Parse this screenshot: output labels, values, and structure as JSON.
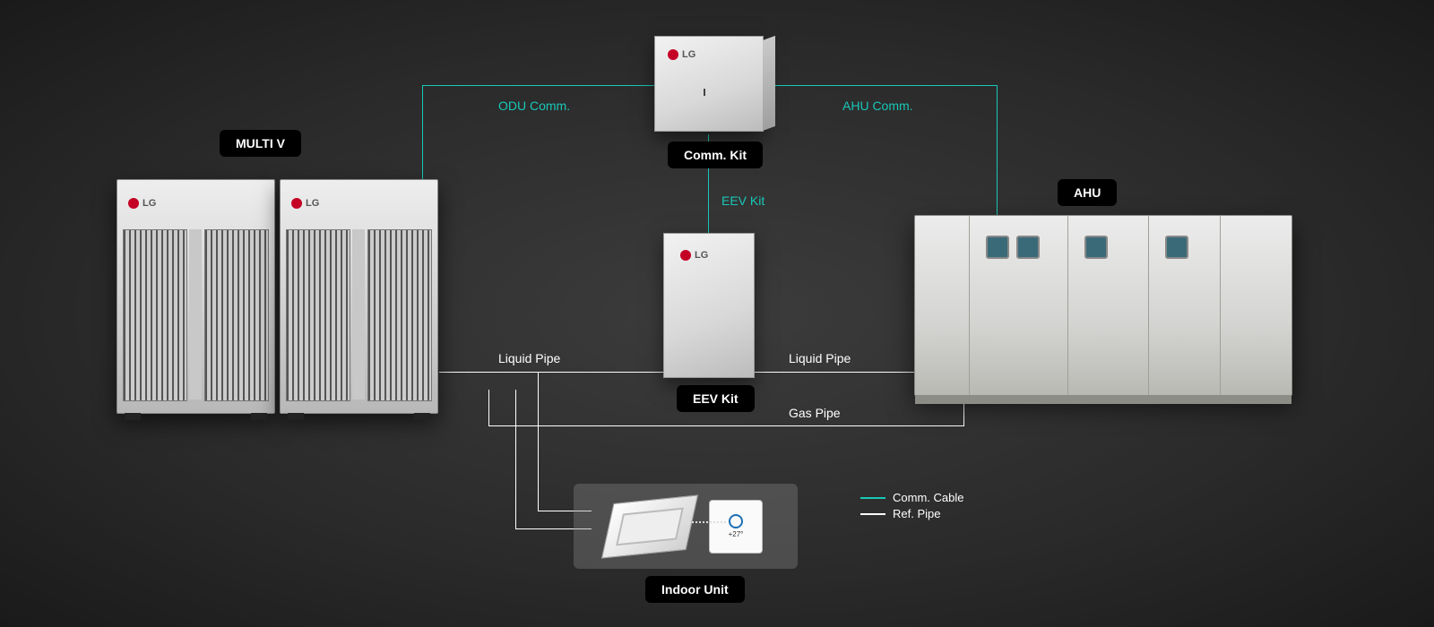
{
  "labels": {
    "multi_v": "MULTI V",
    "comm_kit": "Comm. Kit",
    "eev_kit": "EEV Kit",
    "ahu": "AHU",
    "indoor_unit": "Indoor Unit"
  },
  "lines": {
    "odu_comm": "ODU Comm.",
    "ahu_comm": "AHU Comm.",
    "eev_kit": "EEV Kit",
    "liquid_pipe": "Liquid Pipe",
    "gas_pipe": "Gas Pipe"
  },
  "legend": {
    "comm_cable": "Comm. Cable",
    "ref_pipe": "Ref. Pipe"
  },
  "brand": "LG",
  "remote_display": "+27°"
}
